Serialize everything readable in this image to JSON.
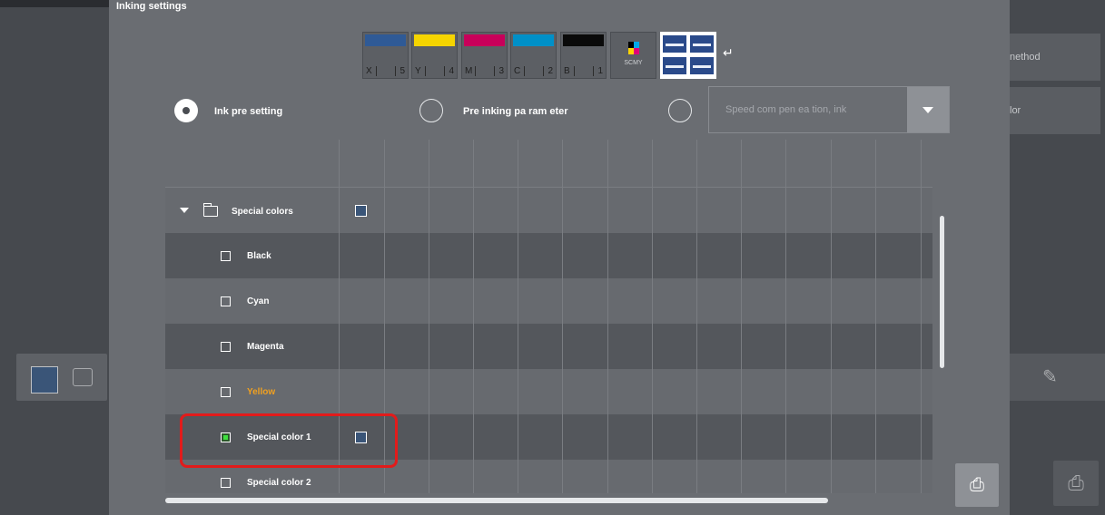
{
  "dialog": {
    "title": "Inking settings"
  },
  "inks": [
    {
      "letter": "X",
      "num": "5",
      "color": "#2f5a96"
    },
    {
      "letter": "Y",
      "num": "4",
      "color": "#f5d400"
    },
    {
      "letter": "M",
      "num": "3",
      "color": "#c8005a"
    },
    {
      "letter": "C",
      "num": "2",
      "color": "#0090c8"
    },
    {
      "letter": "B",
      "num": "1",
      "color": "#0a0a0a"
    }
  ],
  "scmy_label": "SCMY",
  "radios": {
    "ink_presetting": "Ink pre setting",
    "preinking": "Pre inking pa ram eter",
    "speed": "Speed com pen ea tion, ink"
  },
  "tree": {
    "group_label": "Special colors",
    "items": [
      {
        "label": "Black",
        "checked": false,
        "color": "white"
      },
      {
        "label": "Cyan",
        "checked": false,
        "color": "white"
      },
      {
        "label": "Magenta",
        "checked": false,
        "color": "white"
      },
      {
        "label": "Yellow",
        "checked": false,
        "color": "orange"
      },
      {
        "label": "Special color 1",
        "checked": true,
        "color": "white"
      },
      {
        "label": "Special color 2",
        "checked": false,
        "color": "white"
      }
    ]
  },
  "right_panel": {
    "button1": "nethod",
    "button2": "lor"
  },
  "colors": {
    "highlight": "#e21b1b",
    "check_green": "#3fe23f",
    "yellow_text": "#f0a020"
  }
}
